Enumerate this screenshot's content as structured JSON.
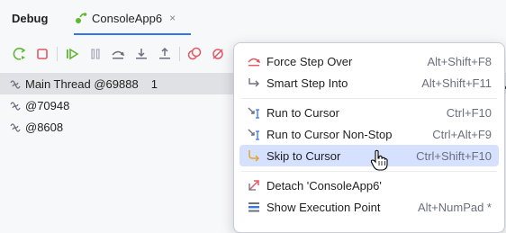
{
  "panel": {
    "title": "Debug",
    "tab": {
      "label": "ConsoleApp6",
      "close": "×",
      "icon": "console-app-icon"
    }
  },
  "toolbar": {
    "buttons": [
      "rerun-icon",
      "stop-icon",
      "resume-icon",
      "pause-icon",
      "step-over-icon",
      "step-into-icon",
      "step-out-icon",
      "view-breakpoints-icon",
      "mute-breakpoints-icon"
    ]
  },
  "threads": [
    {
      "name": "Main Thread @69888",
      "count": "1",
      "selected": true
    },
    {
      "name": "@70948",
      "count": "",
      "selected": false
    },
    {
      "name": "@8608",
      "count": "",
      "selected": false
    }
  ],
  "edge_text": "A",
  "context_menu": {
    "items": [
      {
        "label": "Force Step Over",
        "shortcut": "Alt+Shift+F8",
        "icon": "force-step-over-icon",
        "highlighted": false
      },
      {
        "label": "Smart Step Into",
        "shortcut": "Alt+Shift+F11",
        "icon": "smart-step-into-icon",
        "highlighted": false
      },
      {
        "label": "Run to Cursor",
        "shortcut": "Ctrl+F10",
        "icon": "run-to-cursor-icon",
        "highlighted": false
      },
      {
        "label": "Run to Cursor Non-Stop",
        "shortcut": "Ctrl+Alt+F9",
        "icon": "run-to-cursor-nonstop-icon",
        "highlighted": false
      },
      {
        "label": "Skip to Cursor",
        "shortcut": "Ctrl+Shift+F10",
        "icon": "skip-to-cursor-icon",
        "highlighted": true
      },
      {
        "label": "Detach 'ConsoleApp6'",
        "shortcut": "",
        "icon": "detach-icon",
        "highlighted": false
      },
      {
        "label": "Show Execution Point",
        "shortcut": "Alt+NumPad *",
        "icon": "show-execution-point-icon",
        "highlighted": false
      }
    ]
  },
  "colors": {
    "accent": "#3574f0",
    "menu_highlight": "#d5e1ff",
    "selection": "#dfe1e5"
  }
}
